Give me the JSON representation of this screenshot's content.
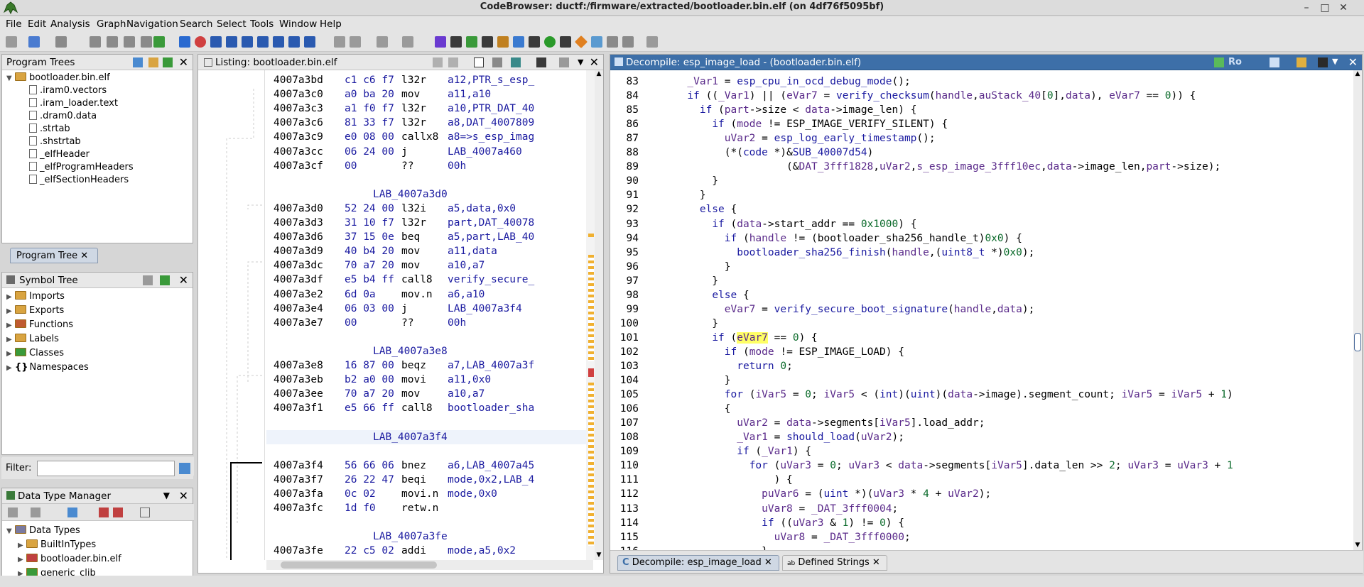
{
  "window": {
    "title": "CodeBrowser: ductf:/firmware/extracted/bootloader.bin.elf (on 4df76f5095bf)",
    "controls": [
      "–",
      "□",
      "✕"
    ]
  },
  "menu": [
    "File",
    "Edit",
    "Analysis",
    "Graph",
    "Navigation",
    "Search",
    "Select",
    "Tools",
    "Window",
    "Help"
  ],
  "program_trees": {
    "title": "Program Trees",
    "root": "bootloader.bin.elf",
    "items": [
      ".iram0.vectors",
      ".iram_loader.text",
      ".dram0.data",
      ".strtab",
      ".shstrtab",
      "_elfHeader",
      "_elfProgramHeaders",
      "_elfSectionHeaders"
    ],
    "tab": "Program Tree"
  },
  "symbol_tree": {
    "title": "Symbol Tree",
    "items": [
      "Imports",
      "Exports",
      "Functions",
      "Labels",
      "Classes",
      "Namespaces"
    ],
    "filter_label": "Filter:",
    "filter_value": ""
  },
  "dtm": {
    "title": "Data Type Manager",
    "root": "Data Types",
    "items": [
      "BuiltInTypes",
      "bootloader.bin.elf",
      "generic_clib"
    ]
  },
  "listing": {
    "title": "Listing:  bootloader.bin.elf",
    "rows": [
      {
        "t": "i",
        "a": "4007a3bd",
        "b": "c1 c6 f7",
        "m": "l32r",
        "o": "a12,PTR_s_esp_"
      },
      {
        "t": "i",
        "a": "4007a3c0",
        "b": "a0 ba 20",
        "m": "mov",
        "o": "a11,a10"
      },
      {
        "t": "i",
        "a": "4007a3c3",
        "b": "a1 f0 f7",
        "m": "l32r",
        "o": "a10,PTR_DAT_40"
      },
      {
        "t": "i",
        "a": "4007a3c6",
        "b": "81 33 f7",
        "m": "l32r",
        "o": "a8,DAT_4007809"
      },
      {
        "t": "i",
        "a": "4007a3c9",
        "b": "e0 08 00",
        "m": "callx8",
        "o": "a8=>s_esp_imag"
      },
      {
        "t": "i",
        "a": "4007a3cc",
        "b": "06 24 00",
        "m": "j",
        "o": "LAB_4007a460"
      },
      {
        "t": "i",
        "a": "4007a3cf",
        "b": "00",
        "m": "??",
        "o": "00h"
      },
      {
        "t": "b"
      },
      {
        "t": "l",
        "l": "LAB_4007a3d0"
      },
      {
        "t": "i",
        "a": "4007a3d0",
        "b": "52 24 00",
        "m": "l32i",
        "o": "a5,data,0x0"
      },
      {
        "t": "i",
        "a": "4007a3d3",
        "b": "31 10 f7",
        "m": "l32r",
        "o": "part,DAT_40078"
      },
      {
        "t": "i",
        "a": "4007a3d6",
        "b": "37 15 0e",
        "m": "beq",
        "o": "a5,part,LAB_40"
      },
      {
        "t": "i",
        "a": "4007a3d9",
        "b": "40 b4 20",
        "m": "mov",
        "o": "a11,data"
      },
      {
        "t": "i",
        "a": "4007a3dc",
        "b": "70 a7 20",
        "m": "mov",
        "o": "a10,a7"
      },
      {
        "t": "i",
        "a": "4007a3df",
        "b": "e5 b4 ff",
        "m": "call8",
        "o": "verify_secure_"
      },
      {
        "t": "i",
        "a": "4007a3e2",
        "b": "6d 0a",
        "m": "mov.n",
        "o": "a6,a10"
      },
      {
        "t": "i",
        "a": "4007a3e4",
        "b": "06 03 00",
        "m": "j",
        "o": "LAB_4007a3f4"
      },
      {
        "t": "i",
        "a": "4007a3e7",
        "b": "00",
        "m": "??",
        "o": "00h"
      },
      {
        "t": "b"
      },
      {
        "t": "l",
        "l": "LAB_4007a3e8"
      },
      {
        "t": "i",
        "a": "4007a3e8",
        "b": "16 87 00",
        "m": "beqz",
        "o": "a7,LAB_4007a3f"
      },
      {
        "t": "i",
        "a": "4007a3eb",
        "b": "b2 a0 00",
        "m": "movi",
        "o": "a11,0x0"
      },
      {
        "t": "i",
        "a": "4007a3ee",
        "b": "70 a7 20",
        "m": "mov",
        "o": "a10,a7"
      },
      {
        "t": "i",
        "a": "4007a3f1",
        "b": "e5 66 ff",
        "m": "call8",
        "o": "bootloader_sha"
      },
      {
        "t": "b"
      },
      {
        "t": "l",
        "l": "LAB_4007a3f4"
      },
      {
        "t": "b"
      },
      {
        "t": "i",
        "a": "4007a3f4",
        "b": "56 66 06",
        "m": "bnez",
        "o": "a6,LAB_4007a45"
      },
      {
        "t": "i",
        "a": "4007a3f7",
        "b": "26 22 47",
        "m": "beqi",
        "o": "mode,0x2,LAB_4"
      },
      {
        "t": "i",
        "a": "4007a3fa",
        "b": "0c 02",
        "m": "movi.n",
        "o": "mode,0x0"
      },
      {
        "t": "i",
        "a": "4007a3fc",
        "b": "1d f0",
        "m": "retw.n",
        "o": ""
      },
      {
        "t": "b"
      },
      {
        "t": "l",
        "l": "LAB_4007a3fe"
      },
      {
        "t": "i",
        "a": "4007a3fe",
        "b": "22 c5 02",
        "m": "addi",
        "o": "mode,a5,0x2"
      }
    ]
  },
  "decompile": {
    "title": "Decompile: esp_image_load -  (bootloader.bin.elf)",
    "tabs": [
      "Decompile: esp_image_load",
      "Defined Strings"
    ],
    "lines": [
      {
        "n": "83",
        "c": "      _Var1 = esp_cpu_in_ocd_debug_mode();"
      },
      {
        "n": "84",
        "c": "      if ((_Var1) || (eVar7 = verify_checksum(handle,auStack_40[0],data), eVar7 == 0)) {"
      },
      {
        "n": "85",
        "c": "        if (part->size < data->image_len) {"
      },
      {
        "n": "86",
        "c": "          if (mode != ESP_IMAGE_VERIFY_SILENT) {"
      },
      {
        "n": "87",
        "c": "            uVar2 = esp_log_early_timestamp();"
      },
      {
        "n": "88",
        "c": "            (*(code *)&SUB_40007d54)"
      },
      {
        "n": "89",
        "c": "                      (&DAT_3fff1828,uVar2,s_esp_image_3fff10ec,data->image_len,part->size);"
      },
      {
        "n": "90",
        "c": "          }"
      },
      {
        "n": "91",
        "c": "        }"
      },
      {
        "n": "92",
        "c": "        else {"
      },
      {
        "n": "93",
        "c": "          if (data->start_addr == 0x1000) {"
      },
      {
        "n": "94",
        "c": "            if (handle != (bootloader_sha256_handle_t)0x0) {"
      },
      {
        "n": "95",
        "c": "              bootloader_sha256_finish(handle,(uint8_t *)0x0);"
      },
      {
        "n": "96",
        "c": "            }"
      },
      {
        "n": "97",
        "c": "          }"
      },
      {
        "n": "98",
        "c": "          else {"
      },
      {
        "n": "99",
        "c": "            eVar7 = verify_secure_boot_signature(handle,data);"
      },
      {
        "n": "100",
        "c": "          }"
      },
      {
        "n": "101",
        "c": "          if (eVar7 == 0) {"
      },
      {
        "n": "102",
        "c": "            if (mode != ESP_IMAGE_LOAD) {"
      },
      {
        "n": "103",
        "c": "              return 0;"
      },
      {
        "n": "104",
        "c": "            }"
      },
      {
        "n": "105",
        "c": "            for (iVar5 = 0; iVar5 < (int)(uint)(data->image).segment_count; iVar5 = iVar5 + 1)"
      },
      {
        "n": "106",
        "c": "            {"
      },
      {
        "n": "107",
        "c": "              uVar2 = data->segments[iVar5].load_addr;"
      },
      {
        "n": "108",
        "c": "              _Var1 = should_load(uVar2);"
      },
      {
        "n": "109",
        "c": "              if (_Var1) {"
      },
      {
        "n": "110",
        "c": "                for (uVar3 = 0; uVar3 < data->segments[iVar5].data_len >> 2; uVar3 = uVar3 + 1"
      },
      {
        "n": "111",
        "c": "                    ) {"
      },
      {
        "n": "112",
        "c": "                  puVar6 = (uint *)(uVar3 * 4 + uVar2);"
      },
      {
        "n": "113",
        "c": "                  uVar8 = _DAT_3fff0004;"
      },
      {
        "n": "114",
        "c": "                  if ((uVar3 & 1) != 0) {"
      },
      {
        "n": "115",
        "c": "                    uVar8 = _DAT_3fff0000;"
      },
      {
        "n": "116",
        "c": "                  }"
      }
    ]
  }
}
